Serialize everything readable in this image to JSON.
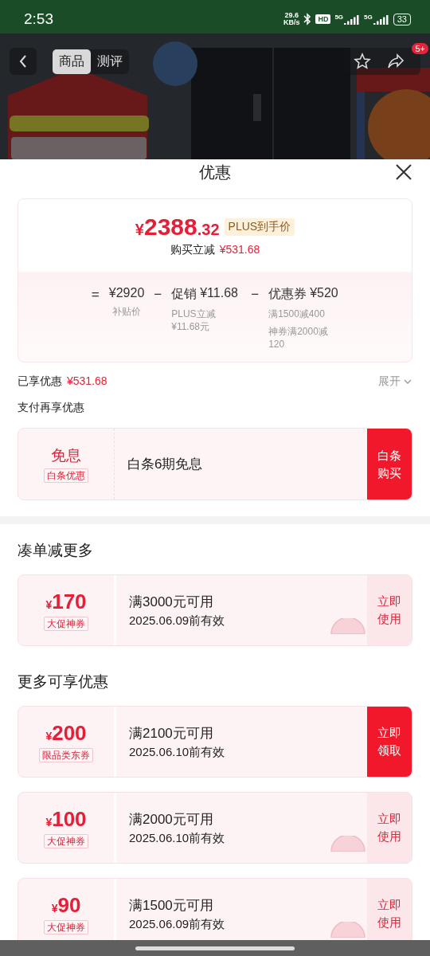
{
  "status_bar": {
    "time": "2:53",
    "net_speed_value": "29.6",
    "net_speed_unit": "KB/s",
    "hd_badge": "HD",
    "network_1": "5G",
    "network_2": "5G",
    "battery": "33"
  },
  "nav": {
    "tabs": [
      {
        "label": "商品",
        "selected": true
      },
      {
        "label": "测评",
        "selected": false
      }
    ],
    "badge": "5+"
  },
  "sheet": {
    "title": "优惠"
  },
  "price_card": {
    "currency": "¥",
    "integer": "2388",
    "decimal": ".32",
    "tag": "PLUS到手价",
    "saving_label": "购买立减",
    "saving_value": "¥531.68",
    "formula": [
      {
        "operator": "=",
        "value": "¥2920",
        "notes": [
          "补贴价"
        ]
      },
      {
        "operator": "−",
        "label": "促销",
        "value": "¥11.68",
        "notes": [
          "PLUS立减 ¥11.68元"
        ]
      },
      {
        "operator": "−",
        "label": "优惠券",
        "value": "¥520",
        "notes": [
          "满1500减400",
          "神券满2000减120"
        ]
      }
    ]
  },
  "enjoyed": {
    "label": "已享优惠",
    "value": "¥531.68",
    "toggle": "展开",
    "expanded": false
  },
  "pay_section": {
    "title": "支付再享优惠",
    "offer": {
      "headline": "免息",
      "tag": "白条优惠",
      "description": "白条6期免息",
      "action": "白条购买"
    }
  },
  "sections": [
    {
      "title": "凑单减更多",
      "coupons": [
        {
          "currency": "¥",
          "amount": "170",
          "tag": "大促神券",
          "condition": "满3000元可用",
          "expiry": "2025.06.09前有效",
          "action": "立即使用",
          "kind": "use",
          "stamped": true
        }
      ]
    },
    {
      "title": "更多可享优惠",
      "coupons": [
        {
          "currency": "¥",
          "amount": "200",
          "tag": "限品类东券",
          "condition": "满2100元可用",
          "expiry": "2025.06.10前有效",
          "action": "立即领取",
          "kind": "claim",
          "stamped": false
        },
        {
          "currency": "¥",
          "amount": "100",
          "tag": "大促神券",
          "condition": "满2000元可用",
          "expiry": "2025.06.10前有效",
          "action": "立即使用",
          "kind": "use",
          "stamped": true
        },
        {
          "currency": "¥",
          "amount": "90",
          "tag": "大促神券",
          "condition": "满1500元可用",
          "expiry": "2025.06.09前有效",
          "action": "立即使用",
          "kind": "use",
          "stamped": true
        }
      ]
    }
  ]
}
